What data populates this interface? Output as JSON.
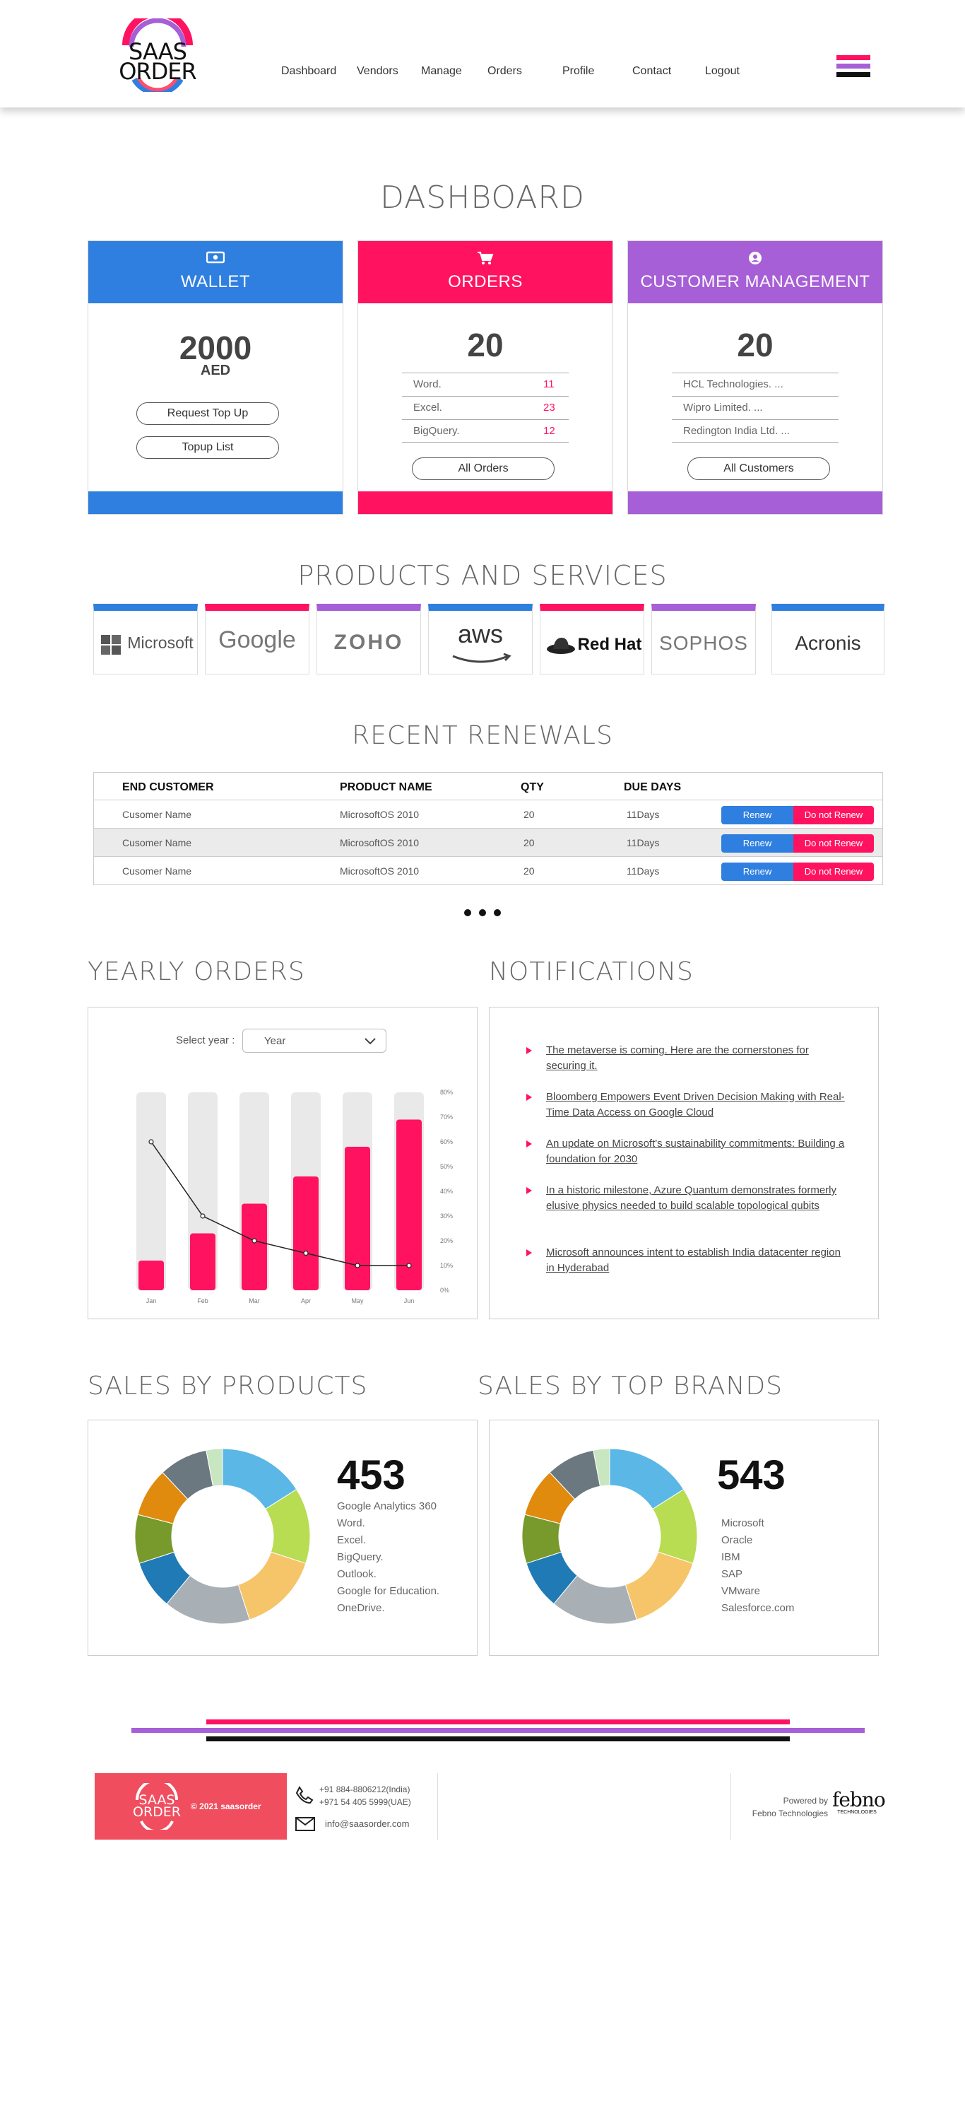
{
  "header": {
    "logo_top": "SAAS",
    "logo_bottom": "ORDER",
    "nav": [
      "Dashboard",
      "Vendors",
      "Manage",
      "Orders",
      "Profile",
      "Contact",
      "Logout"
    ]
  },
  "page_title": "DASHBOARD",
  "cards": {
    "wallet": {
      "title": "WALLET",
      "icon": "money-icon",
      "amount": "2000",
      "currency": "AED",
      "btn1": "Request Top Up",
      "btn2": "Topup List",
      "color": "#2f7fe0"
    },
    "orders": {
      "title": "ORDERS",
      "icon": "cart-icon",
      "count": "20",
      "items": [
        {
          "name": "Word.",
          "qty": "11"
        },
        {
          "name": "Excel.",
          "qty": "23"
        },
        {
          "name": "BigQuery.",
          "qty": "12"
        }
      ],
      "btn": "All Orders",
      "color": "#ff1361"
    },
    "customers": {
      "title": "CUSTOMER MANAGEMENT",
      "icon": "user-circle-icon",
      "count": "20",
      "items": [
        "HCL Technologies. ...",
        "Wipro Limited. ...",
        "Redington India Ltd. ..."
      ],
      "btn": "All Customers",
      "color": "#a65fd6"
    }
  },
  "products_title": "PRODUCTS AND SERVICES",
  "brands": [
    {
      "name": "Microsoft",
      "color": "#2f7fe0"
    },
    {
      "name": "Google",
      "color": "#ff1361"
    },
    {
      "name": "ZOHO",
      "color": "#a65fd6"
    },
    {
      "name": "aws",
      "color": "#2f7fe0"
    },
    {
      "name": "Red Hat",
      "color": "#ff1361"
    },
    {
      "name": "SOPHOS",
      "color": "#a65fd6"
    },
    {
      "name": "Acronis",
      "color": "#2f7fe0"
    }
  ],
  "renewals": {
    "title": "RECENT RENEWALS",
    "headers": [
      "END CUSTOMER",
      "PRODUCT NAME",
      "QTY",
      "DUE DAYS"
    ],
    "rows": [
      {
        "customer": "Cusomer Name",
        "product": "MicrosoftOS 2010",
        "qty": "20",
        "due": "11Days"
      },
      {
        "customer": "Cusomer Name",
        "product": "MicrosoftOS 2010",
        "qty": "20",
        "due": "11Days"
      },
      {
        "customer": "Cusomer Name",
        "product": "MicrosoftOS 2010",
        "qty": "20",
        "due": "11Days"
      }
    ],
    "renew_label": "Renew",
    "no_renew_label": "Do not Renew"
  },
  "yearly": {
    "title": "YEARLY ORDERS",
    "select_label": "Select year :",
    "select_value": "Year"
  },
  "chart_data": {
    "type": "bar",
    "categories": [
      "Jan",
      "Feb",
      "Mar",
      "Apr",
      "May",
      "Jun"
    ],
    "series": [
      {
        "values": [
          12,
          23,
          35,
          46,
          58,
          69
        ]
      },
      {
        "values": [
          60,
          30,
          20,
          15,
          10,
          10
        ]
      }
    ],
    "ylim": [
      0,
      80
    ],
    "yticks": [
      "0%",
      "10%",
      "20%",
      "30%",
      "40%",
      "50%",
      "60%",
      "70%",
      "80%"
    ],
    "colors": {
      "bar": "#ff1361",
      "track": "#e9e9e9",
      "line": "#222222"
    }
  },
  "notifications": {
    "title": "NOTIFICATIONS",
    "items": [
      "The metaverse is coming. Here are the cornerstones for securing it.",
      "Bloomberg Empowers Event Driven Decision Making with Real-Time Data Access on Google Cloud",
      "An update on Microsoft's sustainability commitments: Building a foundation for 2030",
      "In a historic milestone, Azure Quantum demonstrates formerly elusive physics needed to build scalable topological qubits",
      "Microsoft announces intent to establish India datacenter region in Hyderabad"
    ]
  },
  "sales_products": {
    "title": "SALES BY PRODUCTS",
    "total": "453",
    "items": [
      "Google Analytics 360",
      "Word.",
      "Excel.",
      "BigQuery.",
      "Outlook.",
      "Google for Education.",
      "OneDrive."
    ]
  },
  "sales_brands": {
    "title": "SALES BY TOP BRANDS",
    "total": "543",
    "items": [
      "Microsoft",
      "Oracle",
      "IBM",
      "SAP",
      "VMware",
      "Salesforce.com"
    ]
  },
  "donut_colors": [
    "#5ab7e6",
    "#b8dc52",
    "#f6c56a",
    "#a8b0b6",
    "#1f7ab5",
    "#78992c",
    "#e08a0e",
    "#6b7880",
    "#c8e6c0"
  ],
  "donut_fracs": [
    0.16,
    0.14,
    0.15,
    0.16,
    0.09,
    0.09,
    0.09,
    0.09,
    0.03
  ],
  "footer": {
    "copyright": "© 2021 saasorder",
    "phone1": "+91 884-8806212(India)",
    "phone2": "+971 54 405 5999(UAE)",
    "email": "info@saasorder.com",
    "powered": "Powered by",
    "company": "Febno Technologies",
    "febno_logo": "febno",
    "febno_sub": "TECHNOLOGIES"
  }
}
